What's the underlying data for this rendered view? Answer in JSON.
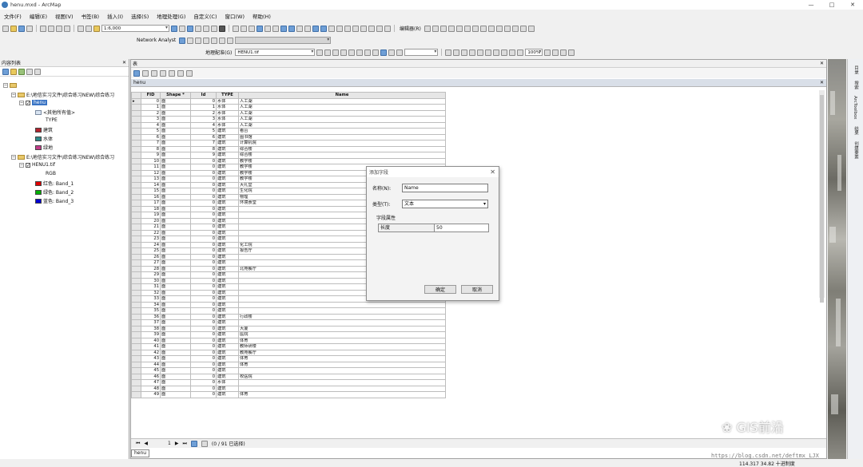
{
  "window": {
    "title": "henu.mxd - ArcMap",
    "minimize": "—",
    "maximize": "□",
    "close": "✕"
  },
  "menu": [
    "文件(F)",
    "编辑(E)",
    "视图(V)",
    "书签(B)",
    "插入(I)",
    "选择(S)",
    "地理处理(G)",
    "自定义(C)",
    "窗口(W)",
    "帮助(H)"
  ],
  "toolbar": {
    "scale": "1:6,000",
    "network_analyst": "Network Analyst",
    "editor": "编辑器(R)",
    "georef": "地理配准(G)",
    "georef_layer": "HENU1.tif",
    "zoom_pct": "100%"
  },
  "toc": {
    "title": "内容列表",
    "items": [
      {
        "label": "E:\\地信实习文件\\综合练习NEW\\综合练习"
      },
      {
        "label": "henu"
      },
      {
        "label": "<其他所有值>"
      },
      {
        "label": "TYPE"
      },
      {
        "label": "建筑",
        "color": "#b3232e"
      },
      {
        "label": "水体",
        "color": "#2d8a8a"
      },
      {
        "label": "绿地",
        "color": "#c23b8a"
      },
      {
        "label": "E:\\地信实习文件\\综合练习NEW\\综合练习"
      },
      {
        "label": "HENU1.tif"
      },
      {
        "label": "RGB"
      },
      {
        "label": "红色:   Band_1",
        "color": "#e00000"
      },
      {
        "label": "绿色:  Band_2",
        "color": "#00b000"
      },
      {
        "label": "蓝色:   Band_3",
        "color": "#0000d0"
      }
    ]
  },
  "table": {
    "window_title": "表",
    "name": "henu",
    "columns": [
      "FID",
      "Shape *",
      "Id",
      "TYPE",
      "Name"
    ],
    "rows": [
      [
        "0",
        "面",
        "0",
        "水体",
        "人工湖"
      ],
      [
        "1",
        "面",
        "1",
        "水体",
        "人工湖"
      ],
      [
        "2",
        "面",
        "2",
        "水体",
        "人工湖"
      ],
      [
        "3",
        "面",
        "3",
        "水体",
        "人工湖"
      ],
      [
        "4",
        "面",
        "4",
        "水体",
        "人工湖"
      ],
      [
        "5",
        "面",
        "5",
        "建筑",
        "看台"
      ],
      [
        "6",
        "面",
        "6",
        "建筑",
        "图书馆"
      ],
      [
        "7",
        "面",
        "7",
        "建筑",
        "计算机院"
      ],
      [
        "8",
        "面",
        "8",
        "建筑",
        "综合楼"
      ],
      [
        "9",
        "面",
        "9",
        "建筑",
        "综合楼"
      ],
      [
        "10",
        "面",
        "0",
        "建筑",
        "教学楼"
      ],
      [
        "11",
        "面",
        "0",
        "建筑",
        "教学楼"
      ],
      [
        "12",
        "面",
        "0",
        "建筑",
        "教学楼"
      ],
      [
        "13",
        "面",
        "0",
        "建筑",
        "教学楼"
      ],
      [
        "14",
        "面",
        "0",
        "建筑",
        "大礼堂"
      ],
      [
        "15",
        "面",
        "0",
        "建筑",
        "生化院"
      ],
      [
        "16",
        "面",
        "0",
        "建筑",
        "物理"
      ],
      [
        "17",
        "面",
        "0",
        "建筑",
        "环境食堂"
      ],
      [
        "18",
        "面",
        "0",
        "建筑",
        ""
      ],
      [
        "19",
        "面",
        "0",
        "建筑",
        ""
      ],
      [
        "20",
        "面",
        "0",
        "建筑",
        ""
      ],
      [
        "21",
        "面",
        "0",
        "建筑",
        ""
      ],
      [
        "22",
        "面",
        "0",
        "建筑",
        ""
      ],
      [
        "23",
        "面",
        "0",
        "建筑",
        ""
      ],
      [
        "24",
        "面",
        "0",
        "建筑",
        "化工院"
      ],
      [
        "25",
        "面",
        "0",
        "建筑",
        "报告厅"
      ],
      [
        "26",
        "面",
        "0",
        "建筑",
        ""
      ],
      [
        "27",
        "面",
        "0",
        "建筑",
        ""
      ],
      [
        "28",
        "面",
        "0",
        "建筑",
        "北苑餐厅"
      ],
      [
        "29",
        "面",
        "0",
        "建筑",
        ""
      ],
      [
        "30",
        "面",
        "0",
        "建筑",
        ""
      ],
      [
        "31",
        "面",
        "0",
        "建筑",
        ""
      ],
      [
        "32",
        "面",
        "0",
        "建筑",
        ""
      ],
      [
        "33",
        "面",
        "0",
        "建筑",
        ""
      ],
      [
        "34",
        "面",
        "0",
        "建筑",
        ""
      ],
      [
        "35",
        "面",
        "0",
        "建筑",
        ""
      ],
      [
        "36",
        "面",
        "0",
        "建筑",
        "行政楼"
      ],
      [
        "37",
        "面",
        "0",
        "建筑",
        ""
      ],
      [
        "38",
        "面",
        "0",
        "建筑",
        "大厦"
      ],
      [
        "39",
        "面",
        "0",
        "建筑",
        "医院"
      ],
      [
        "40",
        "面",
        "0",
        "建筑",
        "体育"
      ],
      [
        "41",
        "面",
        "0",
        "建筑",
        "教师研楼"
      ],
      [
        "42",
        "面",
        "0",
        "建筑",
        "教苑餐厅"
      ],
      [
        "43",
        "面",
        "0",
        "建筑",
        "体育"
      ],
      [
        "44",
        "面",
        "0",
        "建筑",
        "体育"
      ],
      [
        "45",
        "面",
        "0",
        "建筑",
        ""
      ],
      [
        "46",
        "面",
        "0",
        "建筑",
        "校医院"
      ],
      [
        "47",
        "面",
        "0",
        "水体",
        ""
      ],
      [
        "48",
        "面",
        "0",
        "建筑",
        ""
      ],
      [
        "49",
        "面",
        "0",
        "建筑",
        "体育"
      ]
    ],
    "footer_page": "1",
    "footer_status": "(0 / 91 已选择)"
  },
  "dialog": {
    "title": "添加字段",
    "name_label": "名称(N):",
    "name_value": "Name",
    "type_label": "类型(T):",
    "type_value": "文本",
    "props_label": "字段属性",
    "len_label": "长度",
    "len_value": "50",
    "ok": "确定",
    "cancel": "取消"
  },
  "right_dock": [
    "目录",
    "搜索",
    "ArcToolbox",
    "结果",
    "创建要素"
  ],
  "status": {
    "coords": "114.317  34.82 十进制度"
  },
  "watermark": {
    "brand": "GIS前沿",
    "url": "https://blog.csdn.net/deftmx_LJX"
  }
}
